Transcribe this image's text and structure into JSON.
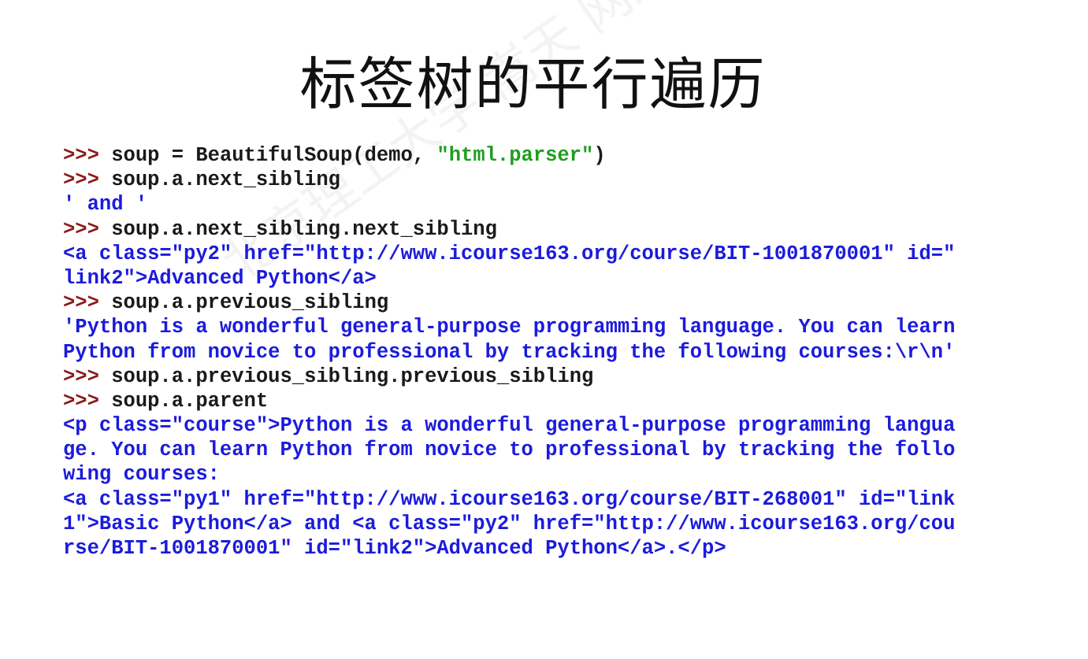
{
  "slide": {
    "title": "标签树的平行遍历",
    "watermark": "北京理工大学 嵩天 网络爬虫与信息提取"
  },
  "code_lines": [
    {
      "type": "input",
      "prompt": ">>>",
      "text": " soup = BeautifulSoup(demo, ",
      "string": "\"html.parser\"",
      "tail": ")"
    },
    {
      "type": "input",
      "prompt": ">>>",
      "text": " soup.a.next_sibling"
    },
    {
      "type": "output",
      "text": "' and '"
    },
    {
      "type": "input",
      "prompt": ">>>",
      "text": " soup.a.next_sibling.next_sibling"
    },
    {
      "type": "output",
      "text": "<a class=\"py2\" href=\"http://www.icourse163.org/course/BIT-1001870001\" id=\""
    },
    {
      "type": "output",
      "text": "link2\">Advanced Python</a>"
    },
    {
      "type": "input",
      "prompt": ">>>",
      "text": " soup.a.previous_sibling"
    },
    {
      "type": "output",
      "text": "'Python is a wonderful general-purpose programming language. You can learn"
    },
    {
      "type": "output",
      "text": "Python from novice to professional by tracking the following courses:\\r\\n'"
    },
    {
      "type": "input",
      "prompt": ">>>",
      "text": " soup.a.previous_sibling.previous_sibling"
    },
    {
      "type": "input",
      "prompt": ">>>",
      "text": " soup.a.parent"
    },
    {
      "type": "output",
      "text": "<p class=\"course\">Python is a wonderful general-purpose programming langua"
    },
    {
      "type": "output",
      "text": "ge. You can learn Python from novice to professional by tracking the follo"
    },
    {
      "type": "output",
      "text": "wing courses:"
    },
    {
      "type": "output",
      "text": "<a class=\"py1\" href=\"http://www.icourse163.org/course/BIT-268001\" id=\"link"
    },
    {
      "type": "output",
      "text": "1\">Basic Python</a> and <a class=\"py2\" href=\"http://www.icourse163.org/cou"
    },
    {
      "type": "output",
      "text": "rse/BIT-1001870001\" id=\"link2\">Advanced Python</a>.</p>"
    }
  ],
  "colors": {
    "prompt": "#8b1a1a",
    "command": "#1a1a1a",
    "string_literal": "#1f9e1f",
    "output": "#1b1bdc"
  }
}
